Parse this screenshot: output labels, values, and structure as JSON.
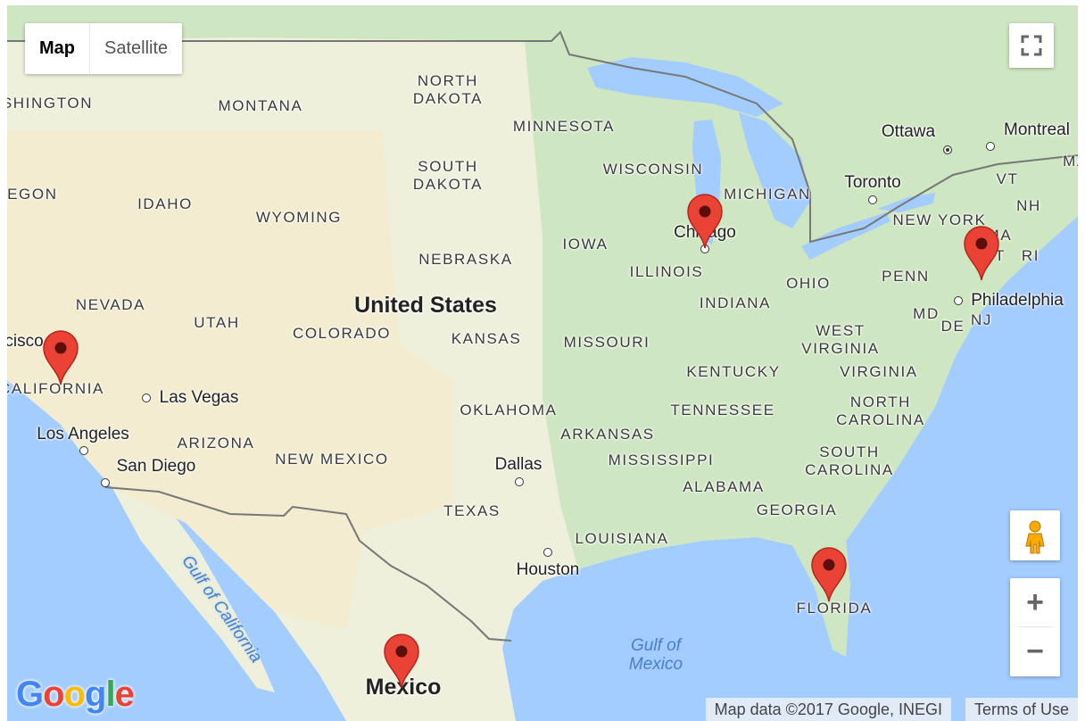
{
  "map_type": {
    "options": [
      "Map",
      "Satellite"
    ],
    "selected": "Map"
  },
  "colors": {
    "water": "#a3ccff",
    "land": "#eef0dc",
    "green": "#cfe6c2",
    "desert": "#f3ecd0",
    "marker": "#ea4335"
  },
  "labels": {
    "states": [
      "WASHINGTON",
      "MONTANA",
      "NORTH",
      "DAKOTA",
      "MINNESOTA",
      "SOUTH",
      "DAKOTA",
      "WISCONSIN",
      "MICHIGAN",
      "OREGON",
      "IDAHO",
      "WYOMING",
      "IOWA",
      "NEBRASKA",
      "ILLINOIS",
      "OHIO",
      "PENN",
      "NEVADA",
      "UTAH",
      "COLORADO",
      "KANSAS",
      "MISSOURI",
      "INDIANA",
      "WEST",
      "VIRGINIA",
      "KENTUCKY",
      "VIRGINIA",
      "MD",
      "DE",
      "NJ",
      "NORTH",
      "CAROLINA",
      "TENNESSEE",
      "OKLAHOMA",
      "ARKANSAS",
      "ARIZONA",
      "NEW MEXICO",
      "MISSISSIPPI",
      "SOUTH",
      "CAROLINA",
      "ALABAMA",
      "TEXAS",
      "GEORGIA",
      "LOUISIANA",
      "FLORIDA",
      "CALIFORNIA",
      "VT",
      "NH",
      "MA",
      "CT",
      "RI",
      "MAINE",
      "NEW YORK"
    ],
    "cities": [
      "Las Vegas",
      "Los Angeles",
      "San Diego",
      "Dallas",
      "Houston",
      "Chicago",
      "Toronto",
      "Ottawa",
      "Montreal",
      "Philadelphia",
      "San Francisco"
    ],
    "countries": [
      "United States",
      "Mexico"
    ],
    "water": [
      "Gulf of California",
      "Gulf of",
      "Mexico"
    ]
  },
  "markers": [
    "California",
    "Chicago",
    "New York",
    "Florida",
    "Mexico"
  ],
  "controls": {
    "fullscreen": "fullscreen-icon",
    "pegman": "street-view-pegman-icon",
    "zoom_in": "+",
    "zoom_out": "−"
  },
  "attribution": {
    "map_data": "Map data ©2017 Google, INEGI",
    "terms": "Terms of Use"
  },
  "logo": "Google"
}
